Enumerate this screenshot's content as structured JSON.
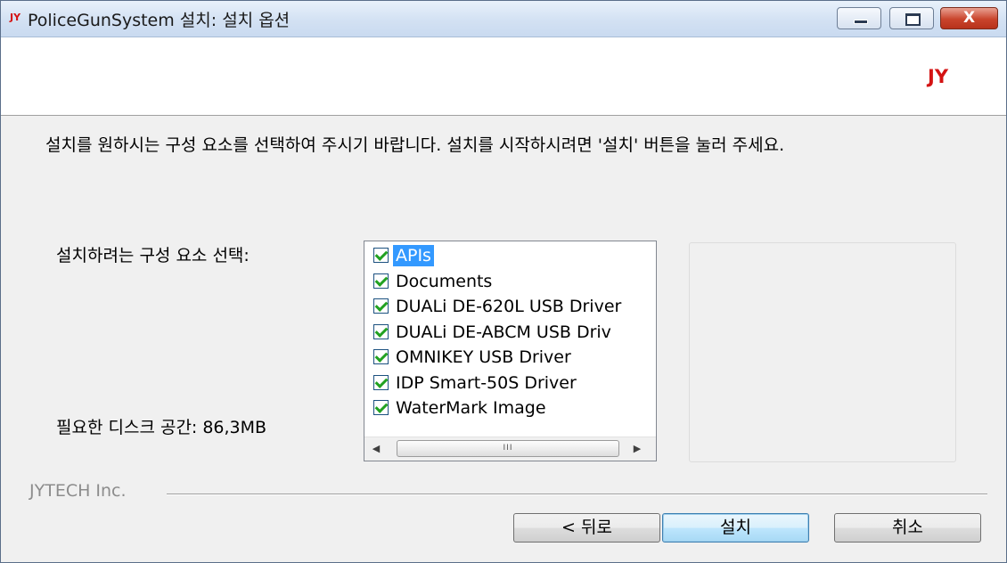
{
  "window": {
    "logo": "JY",
    "title": "PoliceGunSystem 설치: 설치 옵션",
    "close_glyph": "X"
  },
  "header": {
    "logo": "JY"
  },
  "instruction": "설치를 원하시는 구성 요소를 선택하여 주시기 바랍니다. 설치를 시작하시려면 '설치' 버튼을 눌러 주세요.",
  "select_label": "설치하려는 구성 요소 선택:",
  "disk_space": {
    "label": "필요한 디스크 공간:",
    "value": "86,3MB"
  },
  "components": [
    {
      "label": "APIs",
      "checked": true,
      "selected": true
    },
    {
      "label": "Documents",
      "checked": true,
      "selected": false
    },
    {
      "label": "DUALi DE-620L USB Driver",
      "checked": true,
      "selected": false
    },
    {
      "label": "DUALi DE-ABCM USB Driv",
      "checked": true,
      "selected": false
    },
    {
      "label": "OMNIKEY USB Driver",
      "checked": true,
      "selected": false
    },
    {
      "label": "IDP Smart-50S Driver",
      "checked": true,
      "selected": false
    },
    {
      "label": "WaterMark Image",
      "checked": true,
      "selected": false
    }
  ],
  "scrollbar": {
    "left_arrow": "◀",
    "right_arrow": "▶",
    "thumb_grip": "III"
  },
  "footer": {
    "brand": "JYTECH Inc.",
    "back_label": "< 뒤로",
    "install_label": "설치",
    "cancel_label": "취소"
  },
  "colors": {
    "logo_red": "#d41313",
    "selection_blue": "#3399ff",
    "check_green": "#21a121"
  }
}
